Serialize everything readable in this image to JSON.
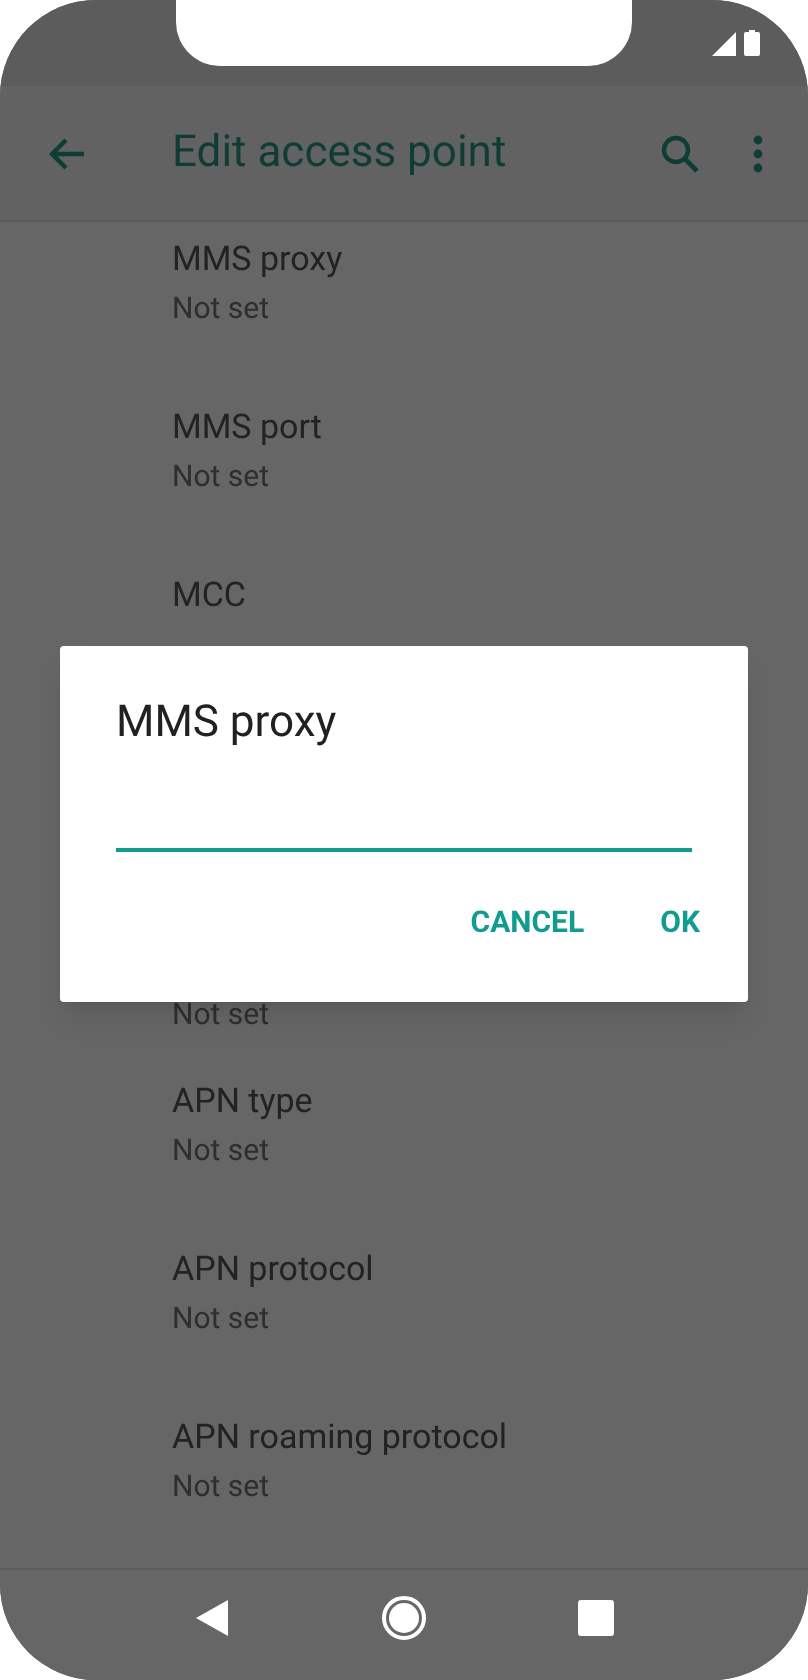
{
  "toolbar": {
    "title": "Edit access point"
  },
  "items": [
    {
      "title": "MMS proxy",
      "summary": "Not set"
    },
    {
      "title": "MMS port",
      "summary": "Not set"
    },
    {
      "title": "MCC"
    },
    {
      "summary": "Not set"
    },
    {
      "title": "APN type",
      "summary": "Not set"
    },
    {
      "title": "APN protocol",
      "summary": "Not set"
    },
    {
      "title": "APN roaming protocol",
      "summary": "Not set"
    }
  ],
  "dialog": {
    "title": "MMS proxy",
    "buttons": [
      "CANCEL",
      "OK"
    ]
  }
}
